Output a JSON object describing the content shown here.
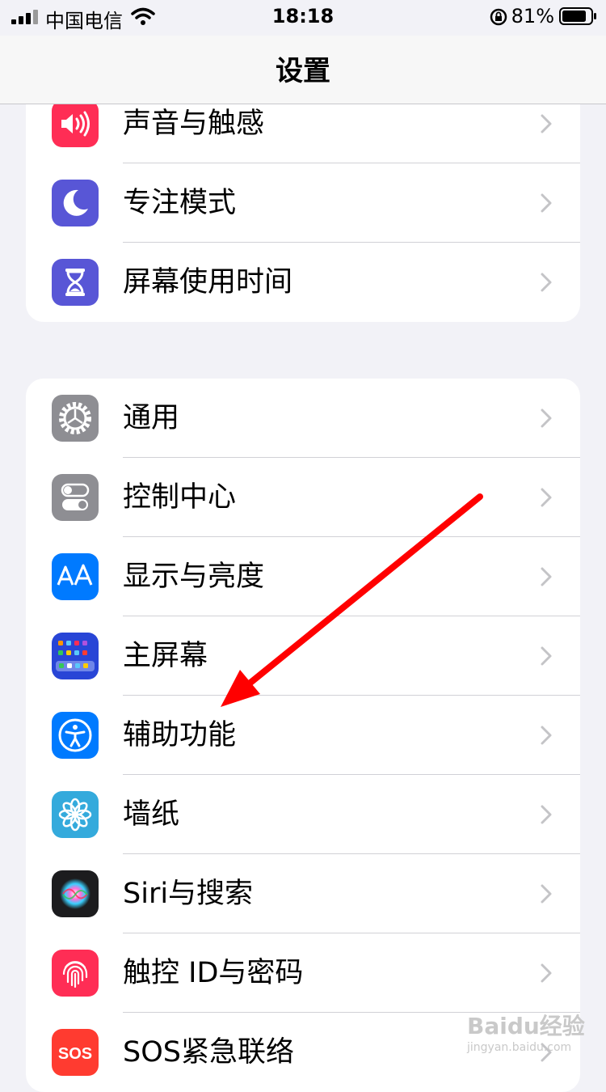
{
  "status_bar": {
    "carrier": "中国电信",
    "time": "18:18",
    "battery": "81%"
  },
  "nav": {
    "title": "设置"
  },
  "groups": [
    {
      "items": [
        {
          "label": "声音与触感",
          "icon": "speaker-icon",
          "color": "#ff2d55"
        },
        {
          "label": "专注模式",
          "icon": "moon-icon",
          "color": "#5856d6"
        },
        {
          "label": "屏幕使用时间",
          "icon": "hourglass-icon",
          "color": "#5856d6"
        }
      ]
    },
    {
      "items": [
        {
          "label": "通用",
          "icon": "gear-icon",
          "color": "#8e8e93"
        },
        {
          "label": "控制中心",
          "icon": "toggles-icon",
          "color": "#8e8e93"
        },
        {
          "label": "显示与亮度",
          "icon": "text-size-icon",
          "color": "#007aff"
        },
        {
          "label": "主屏幕",
          "icon": "home-screen-icon",
          "color": "#2845d6"
        },
        {
          "label": "辅助功能",
          "icon": "accessibility-icon",
          "color": "#007aff"
        },
        {
          "label": "墙纸",
          "icon": "flower-icon",
          "color": "#34aadc"
        },
        {
          "label": "Siri与搜索",
          "icon": "siri-icon",
          "color": "#1c1c1e"
        },
        {
          "label": "触控 ID与密码",
          "icon": "fingerprint-icon",
          "color": "#ff2d55"
        },
        {
          "label": "SOS紧急联络",
          "icon": "sos-icon",
          "color": "#ff3b30",
          "icon_text": "SOS"
        }
      ]
    }
  ],
  "watermark": {
    "text": "Baidu经验",
    "sub": "jingyan.baidu.com"
  },
  "annotation": {
    "arrow_color": "#ff0000"
  }
}
